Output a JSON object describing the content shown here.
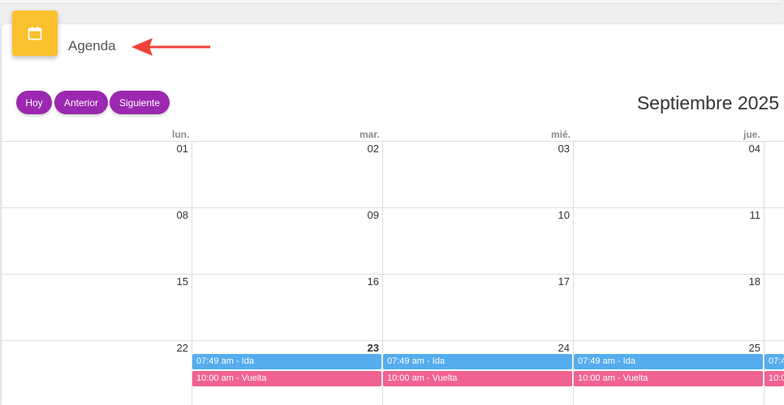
{
  "header": {
    "title": "Agenda",
    "icon": "calendar-icon",
    "icon_color": "#fbc02d"
  },
  "toolbar": {
    "today_label": "Hoy",
    "prev_label": "Anterior",
    "next_label": "Siguiente",
    "button_color": "#9c27b0"
  },
  "calendar": {
    "month_title": "Septiembre 2025",
    "weekdays": [
      "lun.",
      "mar.",
      "mié.",
      "jue."
    ],
    "weeks": [
      [
        "01",
        "02",
        "03",
        "04"
      ],
      [
        "08",
        "09",
        "10",
        "11"
      ],
      [
        "15",
        "16",
        "17",
        "18"
      ],
      [
        "22",
        "23",
        "24",
        "25"
      ]
    ],
    "today": "23",
    "events": {
      "ida_label": "07:49 am - Ida",
      "vuelta_label": "10:00 am - Vuelta",
      "partial_ida": "07:4",
      "partial_vuelta": "10:0",
      "ida_color": "#55acee",
      "vuelta_color": "#f06292"
    }
  }
}
